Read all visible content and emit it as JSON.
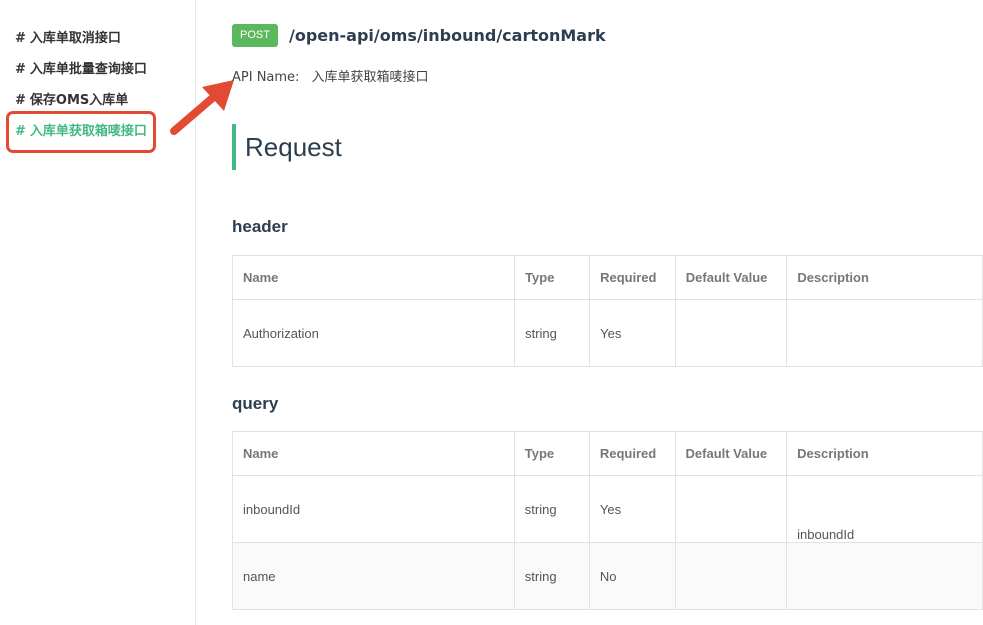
{
  "sidebar": {
    "items": [
      {
        "hash": "#",
        "label": "入库单取消接口"
      },
      {
        "hash": "#",
        "label": "入库单批量查询接口"
      },
      {
        "hash": "#",
        "label": "保存OMS入库单"
      },
      {
        "hash": "#",
        "label": "入库单获取箱唛接口"
      }
    ],
    "active_index": 3
  },
  "endpoint": {
    "method": "POST",
    "path": "/open-api/oms/inbound/cartonMark",
    "api_name_label": "API Name:",
    "api_name_value": "入库单获取箱唛接口"
  },
  "request": {
    "heading": "Request"
  },
  "header_section": {
    "title": "header",
    "columns": [
      "Name",
      "Type",
      "Required",
      "Default Value",
      "Description"
    ],
    "rows": [
      {
        "name": "Authorization",
        "type": "string",
        "required": "Yes",
        "default": "",
        "description": ""
      }
    ]
  },
  "query_section": {
    "title": "query",
    "columns": [
      "Name",
      "Type",
      "Required",
      "Default Value",
      "Description"
    ],
    "rows": [
      {
        "name": "inboundId",
        "type": "string",
        "required": "Yes",
        "default": "",
        "description": "inboundId"
      },
      {
        "name": "name",
        "type": "string",
        "required": "No",
        "default": "",
        "description": ""
      }
    ]
  },
  "colors": {
    "accent": "#42b983",
    "post_badge": "#5cb85c",
    "annotation": "#e34a33"
  }
}
